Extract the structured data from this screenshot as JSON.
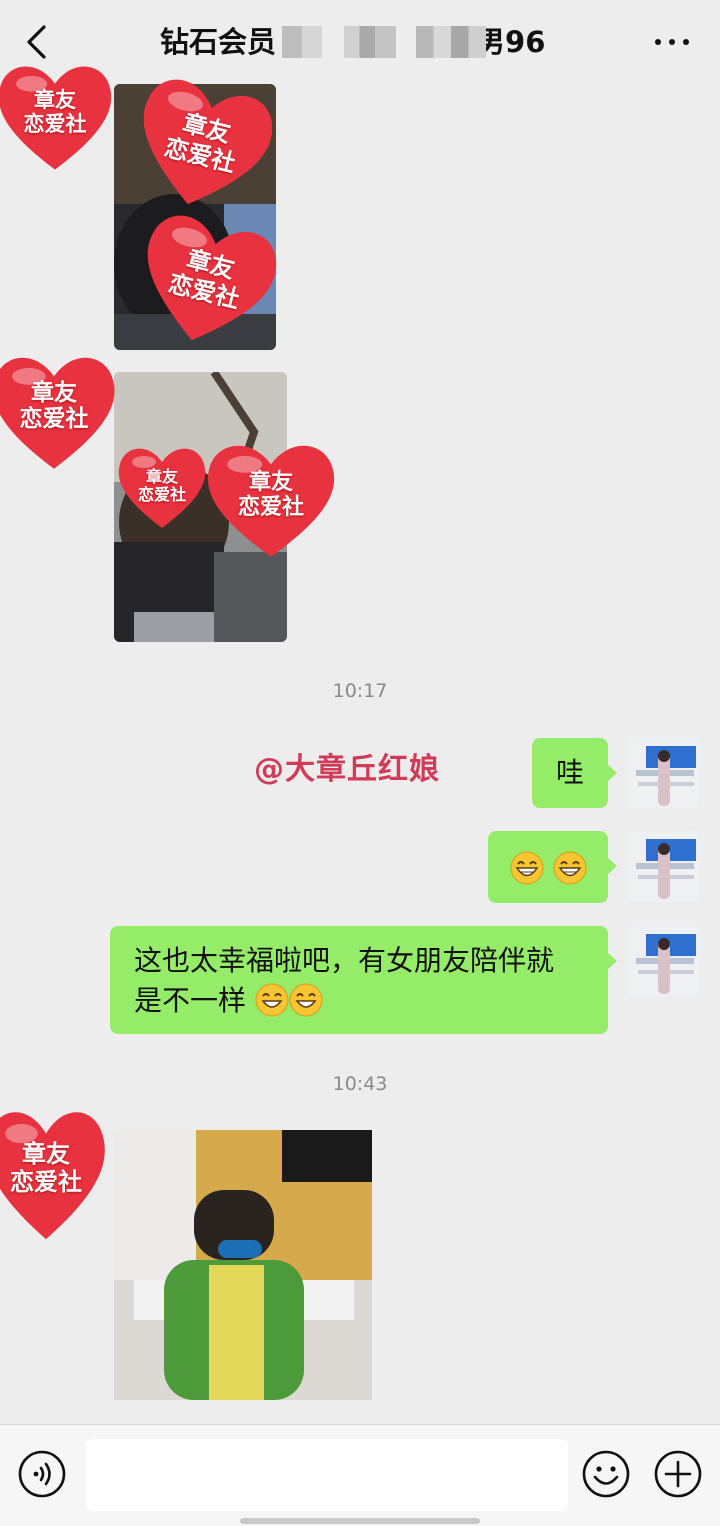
{
  "header": {
    "title_prefix": "钻石会员",
    "title_suffix": "男96",
    "back_icon": "chevron-left-icon",
    "more_icon": "more-dots-icon"
  },
  "watermark": {
    "line1": "章友",
    "line2": "恋爱社",
    "color": "#e8323f"
  },
  "messages": {
    "time1": "10:17",
    "mention": "@大章丘红娘",
    "msg_wa": "哇",
    "msg_long_line1": "这也太幸福啦吧，有女朋友陪伴就",
    "msg_long_line2": "是不一样",
    "time2": "10:43"
  },
  "bottom": {
    "voice_icon": "voice-icon",
    "emoji_icon": "emoji-icon",
    "plus_icon": "plus-icon",
    "input_placeholder": ""
  },
  "colors": {
    "bubble_green": "#95ec69",
    "background": "#ededed",
    "mention_red": "#d13b57"
  }
}
